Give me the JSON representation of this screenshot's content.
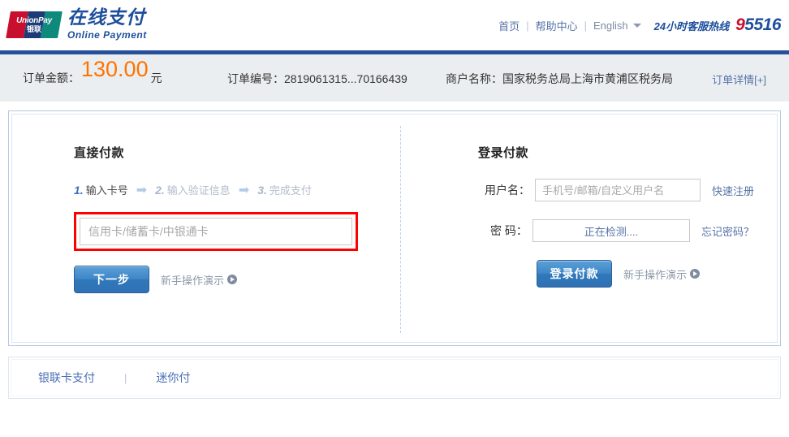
{
  "header": {
    "logo": {
      "mark_en": "UnionPay",
      "mark_cn": "银联",
      "title_cn": "在线支付",
      "title_en": "Online  Payment"
    },
    "nav": {
      "home": "首页",
      "help_center": "帮助中心",
      "language": "English",
      "separator": "|",
      "caret_icon": "chevron-down-icon"
    },
    "hotline": {
      "label": "24小时客服热线",
      "number_red": "9",
      "number_blue": "5516"
    },
    "rule_color": "#27509b"
  },
  "order_bar": {
    "amount_label": "订单金额：",
    "amount_value": "130.00",
    "amount_unit": "元",
    "amount_color": "#ff7300",
    "order_no": "订单编号：2819061315...70166439",
    "merchant": "商户名称：国家税务总局上海市黄浦区税务局",
    "detail_link": "订单详情[+]",
    "background": "#ebeef0"
  },
  "direct_pay": {
    "title": "直接付款",
    "steps": [
      {
        "num": "1.",
        "text": "输入卡号",
        "state": "active"
      },
      {
        "num": "2.",
        "text": "输入验证信息",
        "state": "inactive"
      },
      {
        "num": "3.",
        "text": "完成支付",
        "state": "inactive"
      }
    ],
    "step_arrow": "➡",
    "card_placeholder": "信用卡/储蓄卡/中银通卡",
    "card_value": "",
    "highlight_color": "#ff0000",
    "next_button": "下一步",
    "demo_link": "新手操作演示",
    "demo_icon": "play-circle-icon"
  },
  "login_pay": {
    "title": "登录付款",
    "username_label": "用户名：",
    "username_placeholder": "手机号/邮箱/自定义用户名",
    "username_value": "",
    "register_link": "快速注册",
    "password_label": "密 码：",
    "password_status": "正在检测....",
    "forgot_link": "忘记密码？",
    "login_button": "登录付款",
    "demo_link": "新手操作演示",
    "demo_icon": "play-circle-icon"
  },
  "bottom_tabs": {
    "items": [
      {
        "label": "银联卡支付"
      },
      {
        "label": "迷你付"
      }
    ],
    "separator": "|"
  }
}
